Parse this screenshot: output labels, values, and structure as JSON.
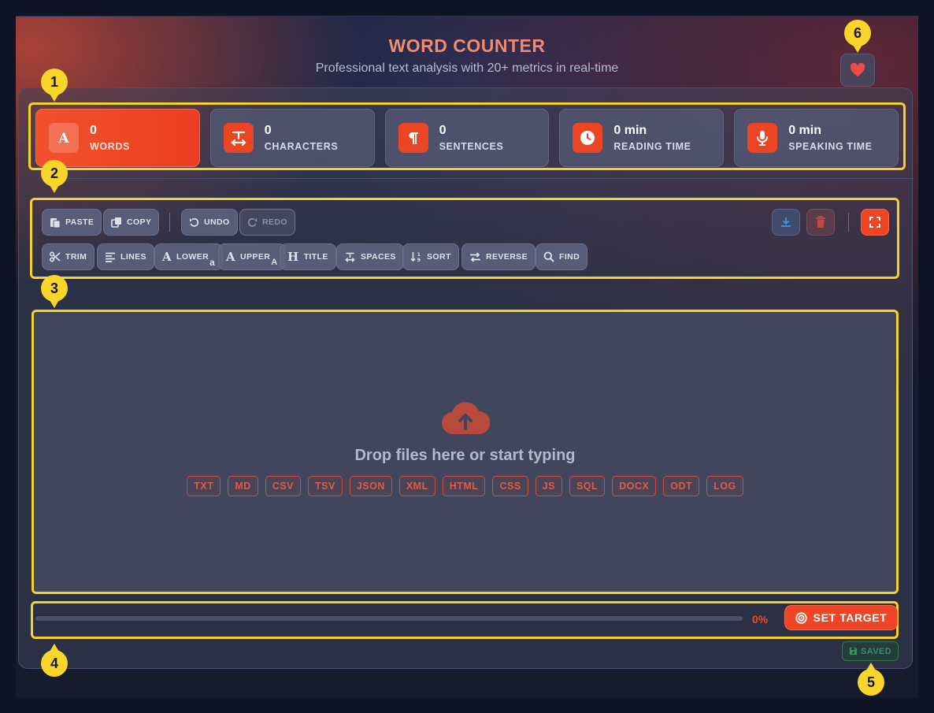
{
  "header": {
    "title": "WORD COUNTER",
    "subtitle": "Professional text analysis with 20+ metrics in real-time"
  },
  "stats": [
    {
      "value": "0",
      "label": "WORDS",
      "icon": "letter-a-icon"
    },
    {
      "value": "0",
      "label": "CHARACTERS",
      "icon": "text-width-icon"
    },
    {
      "value": "0",
      "label": "SENTENCES",
      "icon": "paragraph-icon"
    },
    {
      "value": "0 min",
      "label": "READING TIME",
      "icon": "clock-icon"
    },
    {
      "value": "0 min",
      "label": "SPEAKING TIME",
      "icon": "microphone-icon"
    }
  ],
  "toolbar": {
    "paste": "PASTE",
    "copy": "COPY",
    "undo": "UNDO",
    "redo": "REDO",
    "trim": "TRIM",
    "lines": "LINES",
    "lower": "LOWER",
    "lower_sub": "a",
    "upper": "UPPER",
    "upper_sub": "A",
    "title": "TITLE",
    "spaces": "SPACES",
    "sort": "SORT",
    "reverse": "REVERSE",
    "find": "FIND"
  },
  "editor": {
    "drop_text": "Drop files here or start typing",
    "extensions": [
      "TXT",
      "MD",
      "CSV",
      "TSV",
      "JSON",
      "XML",
      "HTML",
      "CSS",
      "JS",
      "SQL",
      "DOCX",
      "ODT",
      "LOG"
    ]
  },
  "progress": {
    "percent_value": 0,
    "percent_label": "0%",
    "target_label": "SET TARGET"
  },
  "status": {
    "saved_label": "SAVED"
  },
  "markers": [
    "1",
    "2",
    "3",
    "4",
    "5",
    "6"
  ],
  "colors": {
    "accent": "#ef4525",
    "highlight": "#f5d22a",
    "saved": "#2f9a55"
  }
}
